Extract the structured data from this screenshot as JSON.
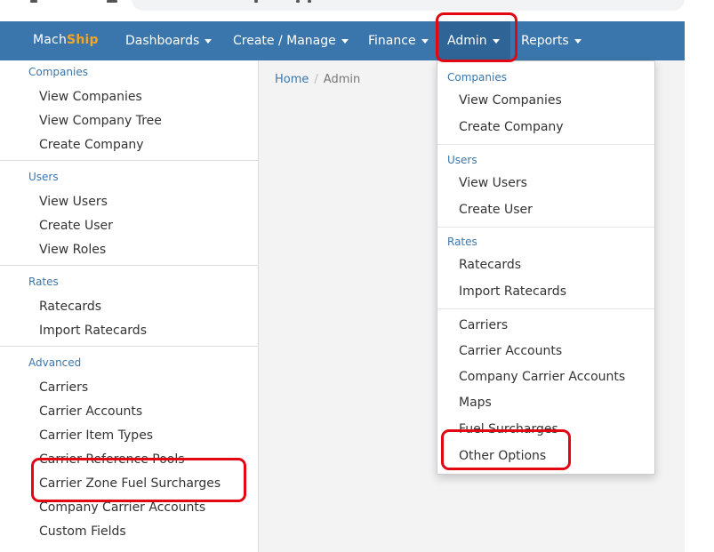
{
  "navbar": {
    "brand_main": "Mach",
    "brand_accent": "Ship",
    "items": [
      "Dashboards",
      "Create / Manage",
      "Finance",
      "Admin",
      "Reports"
    ]
  },
  "breadcrumb": {
    "home": "Home",
    "sep": "/",
    "current": "Admin"
  },
  "sidebar": {
    "companies": {
      "header": "Companies",
      "items": [
        "View Companies",
        "View Company Tree",
        "Create Company"
      ]
    },
    "users": {
      "header": "Users",
      "items": [
        "View Users",
        "Create User",
        "View Roles"
      ]
    },
    "rates": {
      "header": "Rates",
      "items": [
        "Ratecards",
        "Import Ratecards"
      ]
    },
    "advanced": {
      "header": "Advanced",
      "items": [
        "Carriers",
        "Carrier Accounts",
        "Carrier Item Types",
        "Carrier Reference Pools",
        "Carrier Zone Fuel Surcharges",
        "Company Carrier Accounts",
        "Custom Fields"
      ]
    }
  },
  "dropdown": {
    "companies": {
      "header": "Companies",
      "items": [
        "View Companies",
        "Create Company"
      ]
    },
    "users": {
      "header": "Users",
      "items": [
        "View Users",
        "Create User"
      ]
    },
    "rates": {
      "header": "Rates",
      "items": [
        "Ratecards",
        "Import Ratecards"
      ]
    },
    "other": {
      "items": [
        "Carriers",
        "Carrier Accounts",
        "Company Carrier Accounts",
        "Maps",
        "Fuel Surcharges",
        "Other Options"
      ]
    }
  },
  "colors": {
    "navbar": "#3a76ab",
    "accent": "#f5a623",
    "highlight": "#e30613",
    "link": "#3a76ab"
  }
}
